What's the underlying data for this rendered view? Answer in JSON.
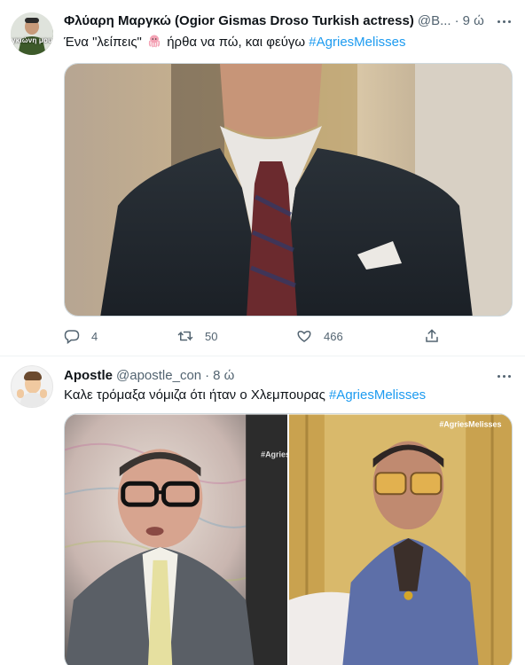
{
  "tweets": [
    {
      "author": {
        "name": "Φλύαρη Μαργκώ (Ogior Gismas Droso Turkish actress)",
        "handle": "@B...",
        "avatar_overlay_text": "γκιώνη μου"
      },
      "time": "9 ώ",
      "text_before": "Ένα \"λείπεις\"",
      "text_after": "ήρθα να πώ, και φεύγω",
      "hashtag": "#AgriesMelisses",
      "media_description": "man in dark suit with red tie",
      "actions": {
        "replies": "4",
        "retweets": "50",
        "likes": "466"
      }
    },
    {
      "author": {
        "name": "Apostle",
        "handle": "@apostle_con"
      },
      "time": "8 ώ",
      "text": "Καλε τρόμαξα νόμιζα ότι ήταν ο Χλεμπουρας",
      "hashtag": "#AgriesMelisses",
      "media_watermarks": [
        "#Agries",
        "#AgriesMelisses"
      ]
    }
  ],
  "colors": {
    "accent": "#1d9bf0",
    "text": "#0f1419",
    "secondary": "#536471",
    "border": "#eff3f4"
  }
}
